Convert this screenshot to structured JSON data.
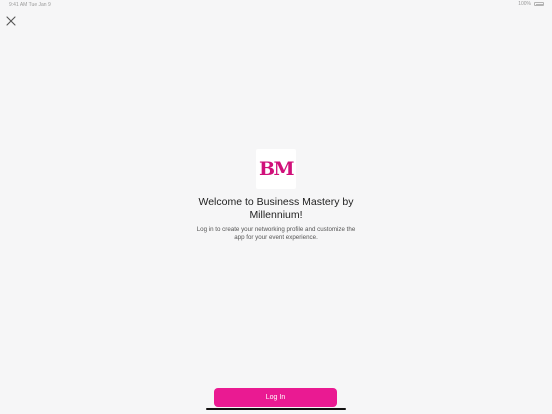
{
  "status_bar": {
    "time": "9:41 AM",
    "date": "Tue Jan 9",
    "battery_label": "100%",
    "battery_level": 1.0
  },
  "close_icon": "close-icon",
  "logo": {
    "text": "BM",
    "color": "#d0107a"
  },
  "welcome": {
    "title": "Welcome to Business Mastery by Millennium!",
    "subtitle": "Log in to create your networking profile and customize the app for your event experience."
  },
  "login_button": {
    "label": "Log In",
    "color": "#ea1a92"
  }
}
